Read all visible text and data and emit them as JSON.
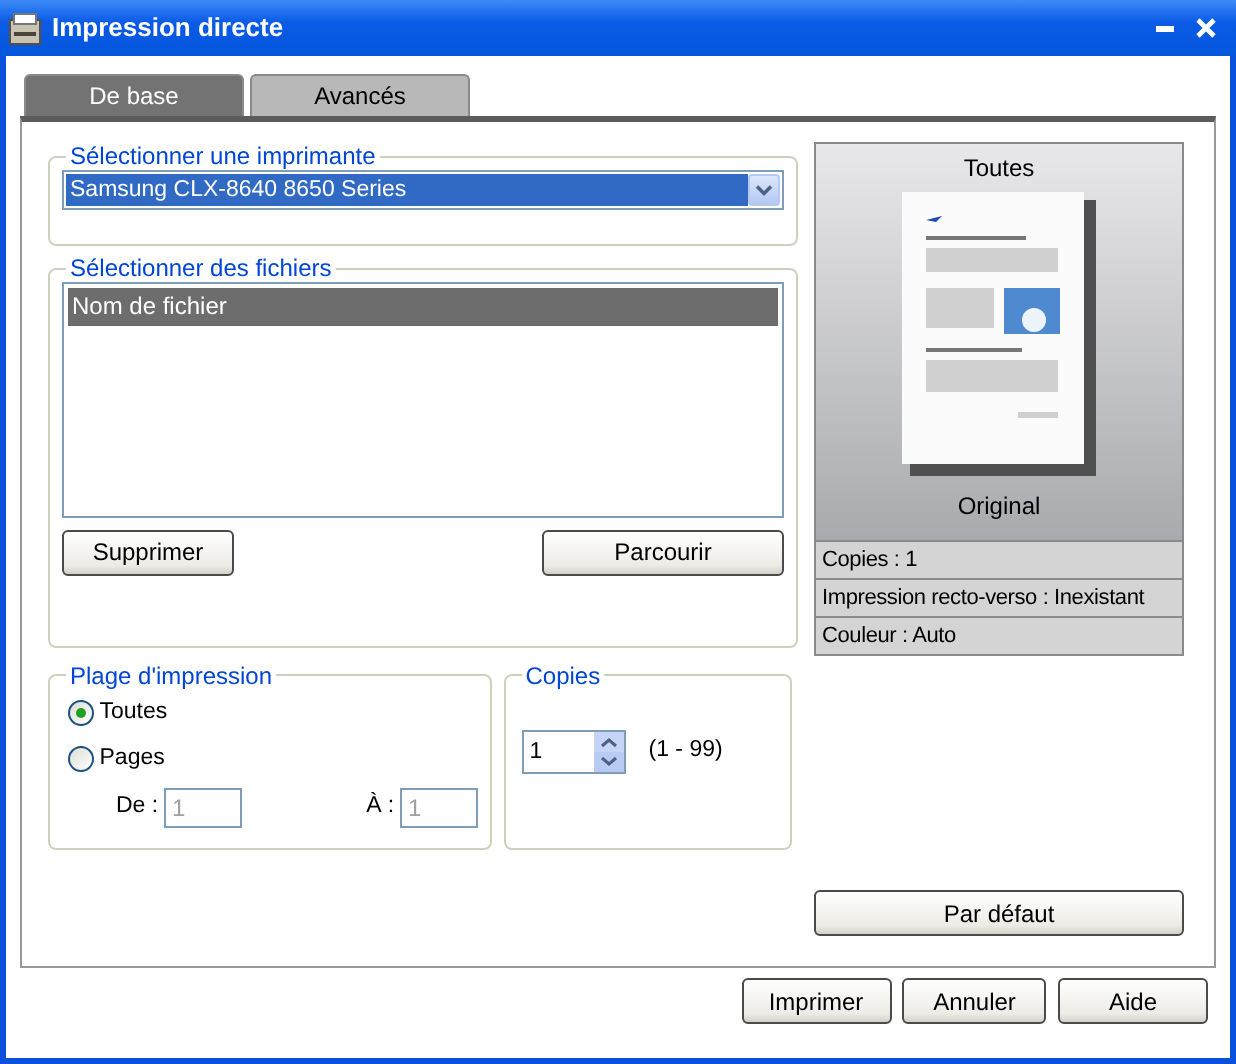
{
  "window": {
    "title": "Impression directe"
  },
  "tabs": [
    {
      "label": "De base",
      "selected": true
    },
    {
      "label": "Avancés",
      "selected": false
    }
  ],
  "printer": {
    "legend": "Sélectionner une imprimante",
    "value": "Samsung CLX-8640 8650 Series"
  },
  "files": {
    "legend": "Sélectionner des fichiers",
    "column": "Nom de fichier",
    "buttons": [
      "Supprimer",
      "Parcourir"
    ]
  },
  "range": {
    "legend": "Plage d'impression",
    "options": [
      {
        "label": "Toutes",
        "selected": true
      },
      {
        "label": "Pages",
        "selected": false
      }
    ],
    "from_label": "De :",
    "from_value": "1",
    "to_label": "À :",
    "to_value": "1",
    "disabled": true
  },
  "copies": {
    "legend": "Copies",
    "value": "1",
    "range": "(1 - 99)"
  },
  "preview": {
    "heading": "Toutes",
    "caption": "Original",
    "info": [
      "Copies : 1",
      "Impression recto-verso : Inexistant",
      "Couleur : Auto"
    ]
  },
  "default_button": "Par défaut",
  "footer_buttons": [
    "Imprimer",
    "Annuler",
    "Aide"
  ]
}
